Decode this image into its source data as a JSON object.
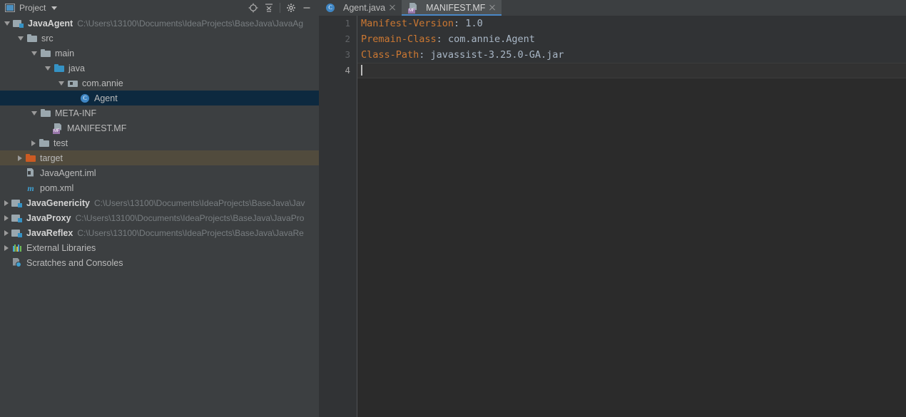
{
  "tool_window": {
    "title": "Project",
    "icon": "project-window-icon",
    "dropdown_icon": "chevron-down-icon",
    "actions": [
      {
        "name": "select-opened-file-icon",
        "label": "Select Opened File"
      },
      {
        "name": "collapse-all-icon",
        "label": "Collapse All"
      },
      {
        "name": "settings-gear-icon",
        "label": "Settings"
      },
      {
        "name": "hide-icon",
        "label": "Hide"
      }
    ]
  },
  "tree": [
    {
      "label": "JavaAgent",
      "path": "C:\\Users\\13100\\Documents\\IdeaProjects\\BaseJava\\JavaAg",
      "icon": "module-icon",
      "indent": 0,
      "arrow": "expanded",
      "bold": true,
      "state": "normal",
      "name": "tree-node-javaagent"
    },
    {
      "label": "src",
      "path": "",
      "icon": "folder-icon",
      "indent": 1,
      "arrow": "expanded",
      "bold": false,
      "state": "normal",
      "name": "tree-node-src"
    },
    {
      "label": "main",
      "path": "",
      "icon": "folder-icon",
      "indent": 2,
      "arrow": "expanded",
      "bold": false,
      "state": "normal",
      "name": "tree-node-main"
    },
    {
      "label": "java",
      "path": "",
      "icon": "source-folder-icon",
      "indent": 3,
      "arrow": "expanded",
      "bold": false,
      "state": "normal",
      "name": "tree-node-java"
    },
    {
      "label": "com.annie",
      "path": "",
      "icon": "package-icon",
      "indent": 4,
      "arrow": "expanded",
      "bold": false,
      "state": "normal",
      "name": "tree-node-com-annie"
    },
    {
      "label": "Agent",
      "path": "",
      "icon": "java-class-icon",
      "indent": 5,
      "arrow": "none",
      "bold": false,
      "state": "selected",
      "name": "tree-node-agent"
    },
    {
      "label": "META-INF",
      "path": "",
      "icon": "folder-icon",
      "indent": 2,
      "arrow": "expanded",
      "bold": false,
      "state": "normal",
      "name": "tree-node-meta-inf"
    },
    {
      "label": "MANIFEST.MF",
      "path": "",
      "icon": "manifest-file-icon",
      "indent": 3,
      "arrow": "none",
      "bold": false,
      "state": "normal",
      "name": "tree-node-manifest-mf"
    },
    {
      "label": "test",
      "path": "",
      "icon": "folder-icon",
      "indent": 2,
      "arrow": "collapsed",
      "bold": false,
      "state": "normal",
      "name": "tree-node-test"
    },
    {
      "label": "target",
      "path": "",
      "icon": "excluded-folder-icon",
      "indent": 1,
      "arrow": "collapsed",
      "bold": false,
      "state": "excluded",
      "name": "tree-node-target"
    },
    {
      "label": "JavaAgent.iml",
      "path": "",
      "icon": "iml-file-icon",
      "indent": 1,
      "arrow": "none",
      "bold": false,
      "state": "normal",
      "name": "tree-node-javaagent-iml"
    },
    {
      "label": "pom.xml",
      "path": "",
      "icon": "maven-file-icon",
      "indent": 1,
      "arrow": "none",
      "bold": false,
      "state": "normal",
      "name": "tree-node-pom-xml"
    },
    {
      "label": "JavaGenericity",
      "path": "C:\\Users\\13100\\Documents\\IdeaProjects\\BaseJava\\Jav",
      "icon": "module-icon",
      "indent": 0,
      "arrow": "collapsed",
      "bold": true,
      "state": "normal",
      "name": "tree-node-javagenericity"
    },
    {
      "label": "JavaProxy",
      "path": "C:\\Users\\13100\\Documents\\IdeaProjects\\BaseJava\\JavaPro",
      "icon": "module-icon",
      "indent": 0,
      "arrow": "collapsed",
      "bold": true,
      "state": "normal",
      "name": "tree-node-javaproxy"
    },
    {
      "label": "JavaReflex",
      "path": "C:\\Users\\13100\\Documents\\IdeaProjects\\BaseJava\\JavaRe",
      "icon": "module-icon",
      "indent": 0,
      "arrow": "collapsed",
      "bold": true,
      "state": "normal",
      "name": "tree-node-javareflex"
    },
    {
      "label": "External Libraries",
      "path": "",
      "icon": "external-libraries-icon",
      "indent": 0,
      "arrow": "collapsed",
      "bold": false,
      "state": "normal",
      "name": "tree-node-external-libraries"
    },
    {
      "label": "Scratches and Consoles",
      "path": "",
      "icon": "scratches-icon",
      "indent": 0,
      "arrow": "none",
      "bold": false,
      "state": "normal",
      "name": "tree-node-scratches-and-consoles"
    }
  ],
  "tabs": [
    {
      "label": "Agent.java",
      "icon": "java-class-icon",
      "active": false,
      "name": "editor-tab-agent-java"
    },
    {
      "label": "MANIFEST.MF",
      "icon": "manifest-file-icon",
      "active": true,
      "name": "editor-tab-manifest-mf"
    }
  ],
  "editor": {
    "gutter": [
      "1",
      "2",
      "3",
      "4"
    ],
    "current_line": 4,
    "lines": [
      {
        "key": "Manifest-Version",
        "sep": ": ",
        "value": "1.0"
      },
      {
        "key": "Premain-Class",
        "sep": ": ",
        "value": "com.annie.Agent"
      },
      {
        "key": "Class-Path",
        "sep": ": ",
        "value": "javassist-3.25.0-GA.jar"
      },
      {
        "key": "",
        "sep": "",
        "value": ""
      }
    ]
  },
  "colors": {
    "sidebar_bg": "#3c3f41",
    "editor_bg": "#2b2b2b",
    "text_bg": "#313335",
    "selection": "#0d293f",
    "excluded": "#514b3d",
    "key": "#cc7832",
    "value": "#a9b7c6",
    "accent": "#4a88c7"
  }
}
